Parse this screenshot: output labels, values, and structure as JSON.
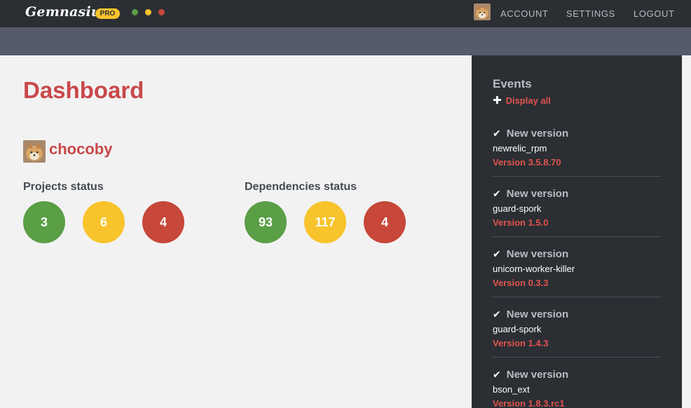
{
  "app": {
    "logo": "Gemnasium",
    "badge": "PRO",
    "window_dots": [
      "#5a9e46",
      "#f8c32b",
      "#c7473a"
    ]
  },
  "nav": {
    "account": "ACCOUNT",
    "settings": "SETTINGS",
    "logout": "LOGOUT"
  },
  "main": {
    "title": "Dashboard",
    "user": "chocoby",
    "projects": {
      "label": "Projects status",
      "green": "3",
      "yellow": "6",
      "red": "4"
    },
    "dependencies": {
      "label": "Dependencies status",
      "green": "93",
      "yellow": "117",
      "red": "4"
    }
  },
  "events": {
    "title": "Events",
    "display_all": "Display all",
    "items": [
      {
        "type": "New version",
        "package": "newrelic_rpm",
        "version": "Version 3.5.8.70"
      },
      {
        "type": "New version",
        "package": "guard-spork",
        "version": "Version 1.5.0"
      },
      {
        "type": "New version",
        "package": "unicorn-worker-killer",
        "version": "Version 0.3.3"
      },
      {
        "type": "New version",
        "package": "guard-spork",
        "version": "Version 1.4.3"
      },
      {
        "type": "New version",
        "package": "bson_ext",
        "version": "Version 1.8.3.rc1"
      }
    ]
  },
  "colors": {
    "accent": "#c9484a",
    "green": "#5a9e46",
    "yellow": "#f8c32b",
    "red": "#c7473a",
    "dark": "#2b2e33"
  }
}
